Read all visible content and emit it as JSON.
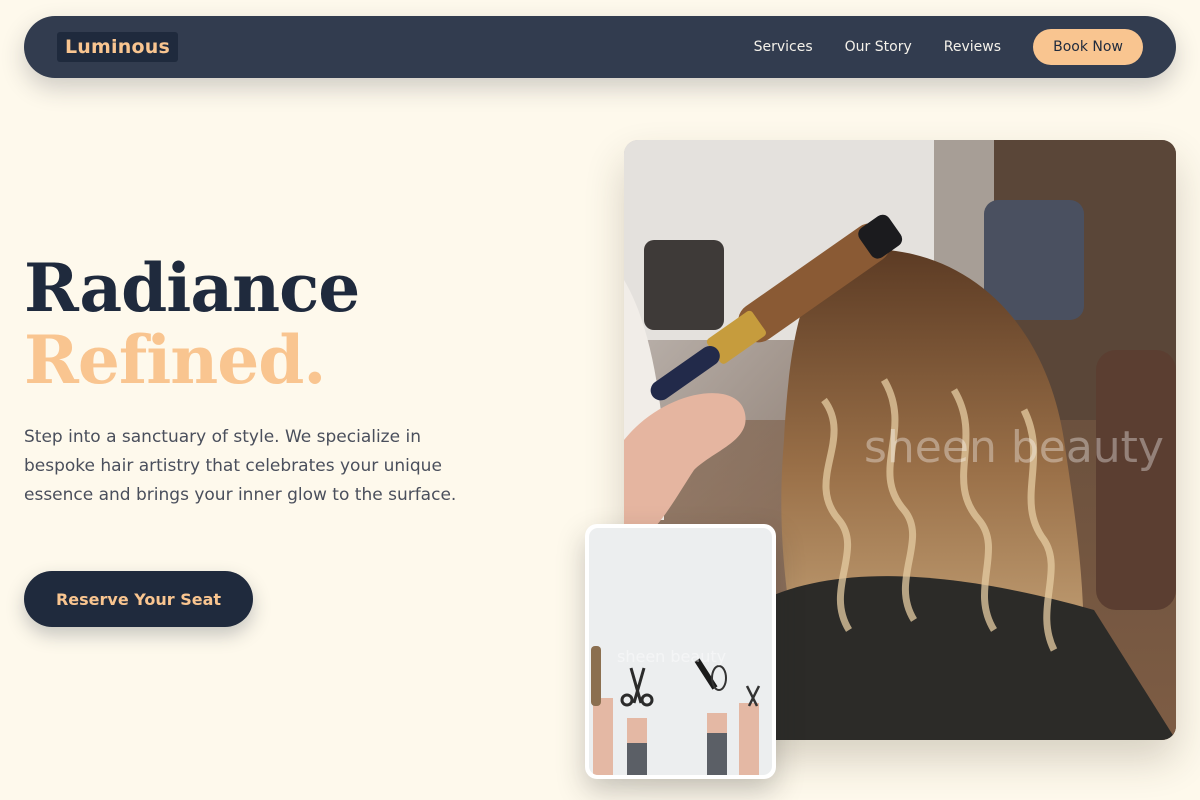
{
  "brand": {
    "name": "Luminous"
  },
  "nav": {
    "links": [
      "Services",
      "Our Story",
      "Reviews"
    ],
    "cta": "Book Now"
  },
  "hero": {
    "title_line1": "Radiance",
    "title_line2": "Refined.",
    "description": "Step into a sanctuary of style. We specialize in bespoke hair artistry that celebrates your unique essence and brings your inner glow to the surface.",
    "cta": "Reserve Your Seat"
  },
  "images": {
    "main_watermark": "sheen beauty",
    "small_watermark": "sheen beauty"
  },
  "colors": {
    "background": "#fef9ec",
    "navy": "#1f2a3d",
    "nav_bar": "#323c4f",
    "accent": "#f9c590"
  }
}
